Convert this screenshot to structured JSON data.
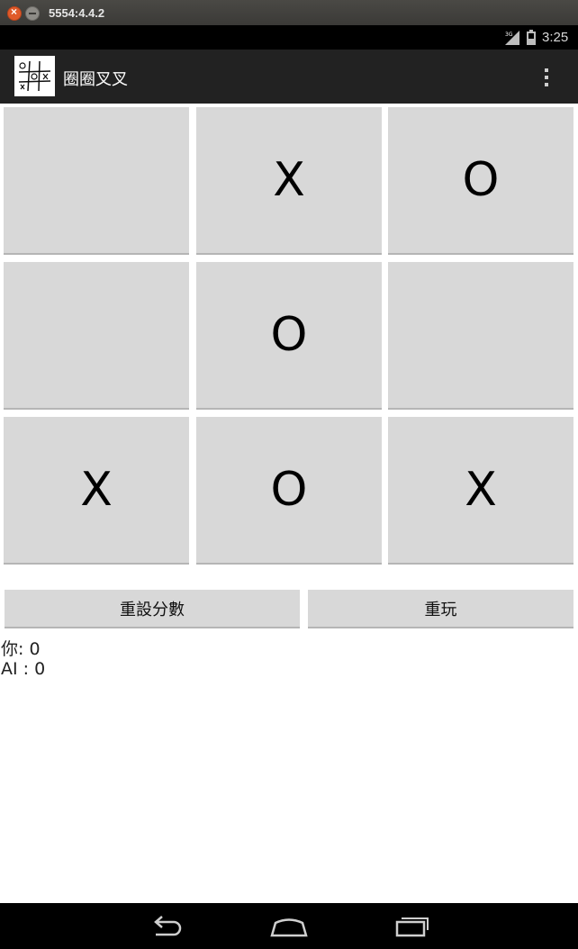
{
  "window": {
    "title": "5554:4.4.2"
  },
  "status": {
    "time": "3:25",
    "network": "3G"
  },
  "actionbar": {
    "title": "圈圈叉叉"
  },
  "board": {
    "cells": [
      "",
      "X",
      "O",
      "",
      "O",
      "",
      "X",
      "O",
      "X"
    ]
  },
  "buttons": {
    "reset_score": "重設分數",
    "replay": "重玩"
  },
  "score": {
    "you": "你: 0",
    "ai": "AI : 0"
  },
  "colors": {
    "cell_bg": "#d8d8d8",
    "actionbar": "#222222",
    "statusbar": "#000000"
  },
  "icons": {
    "app": "tic-tac-toe-icon",
    "overflow": "overflow-menu-icon",
    "back": "back-icon",
    "home": "home-icon",
    "recents": "recents-icon"
  }
}
